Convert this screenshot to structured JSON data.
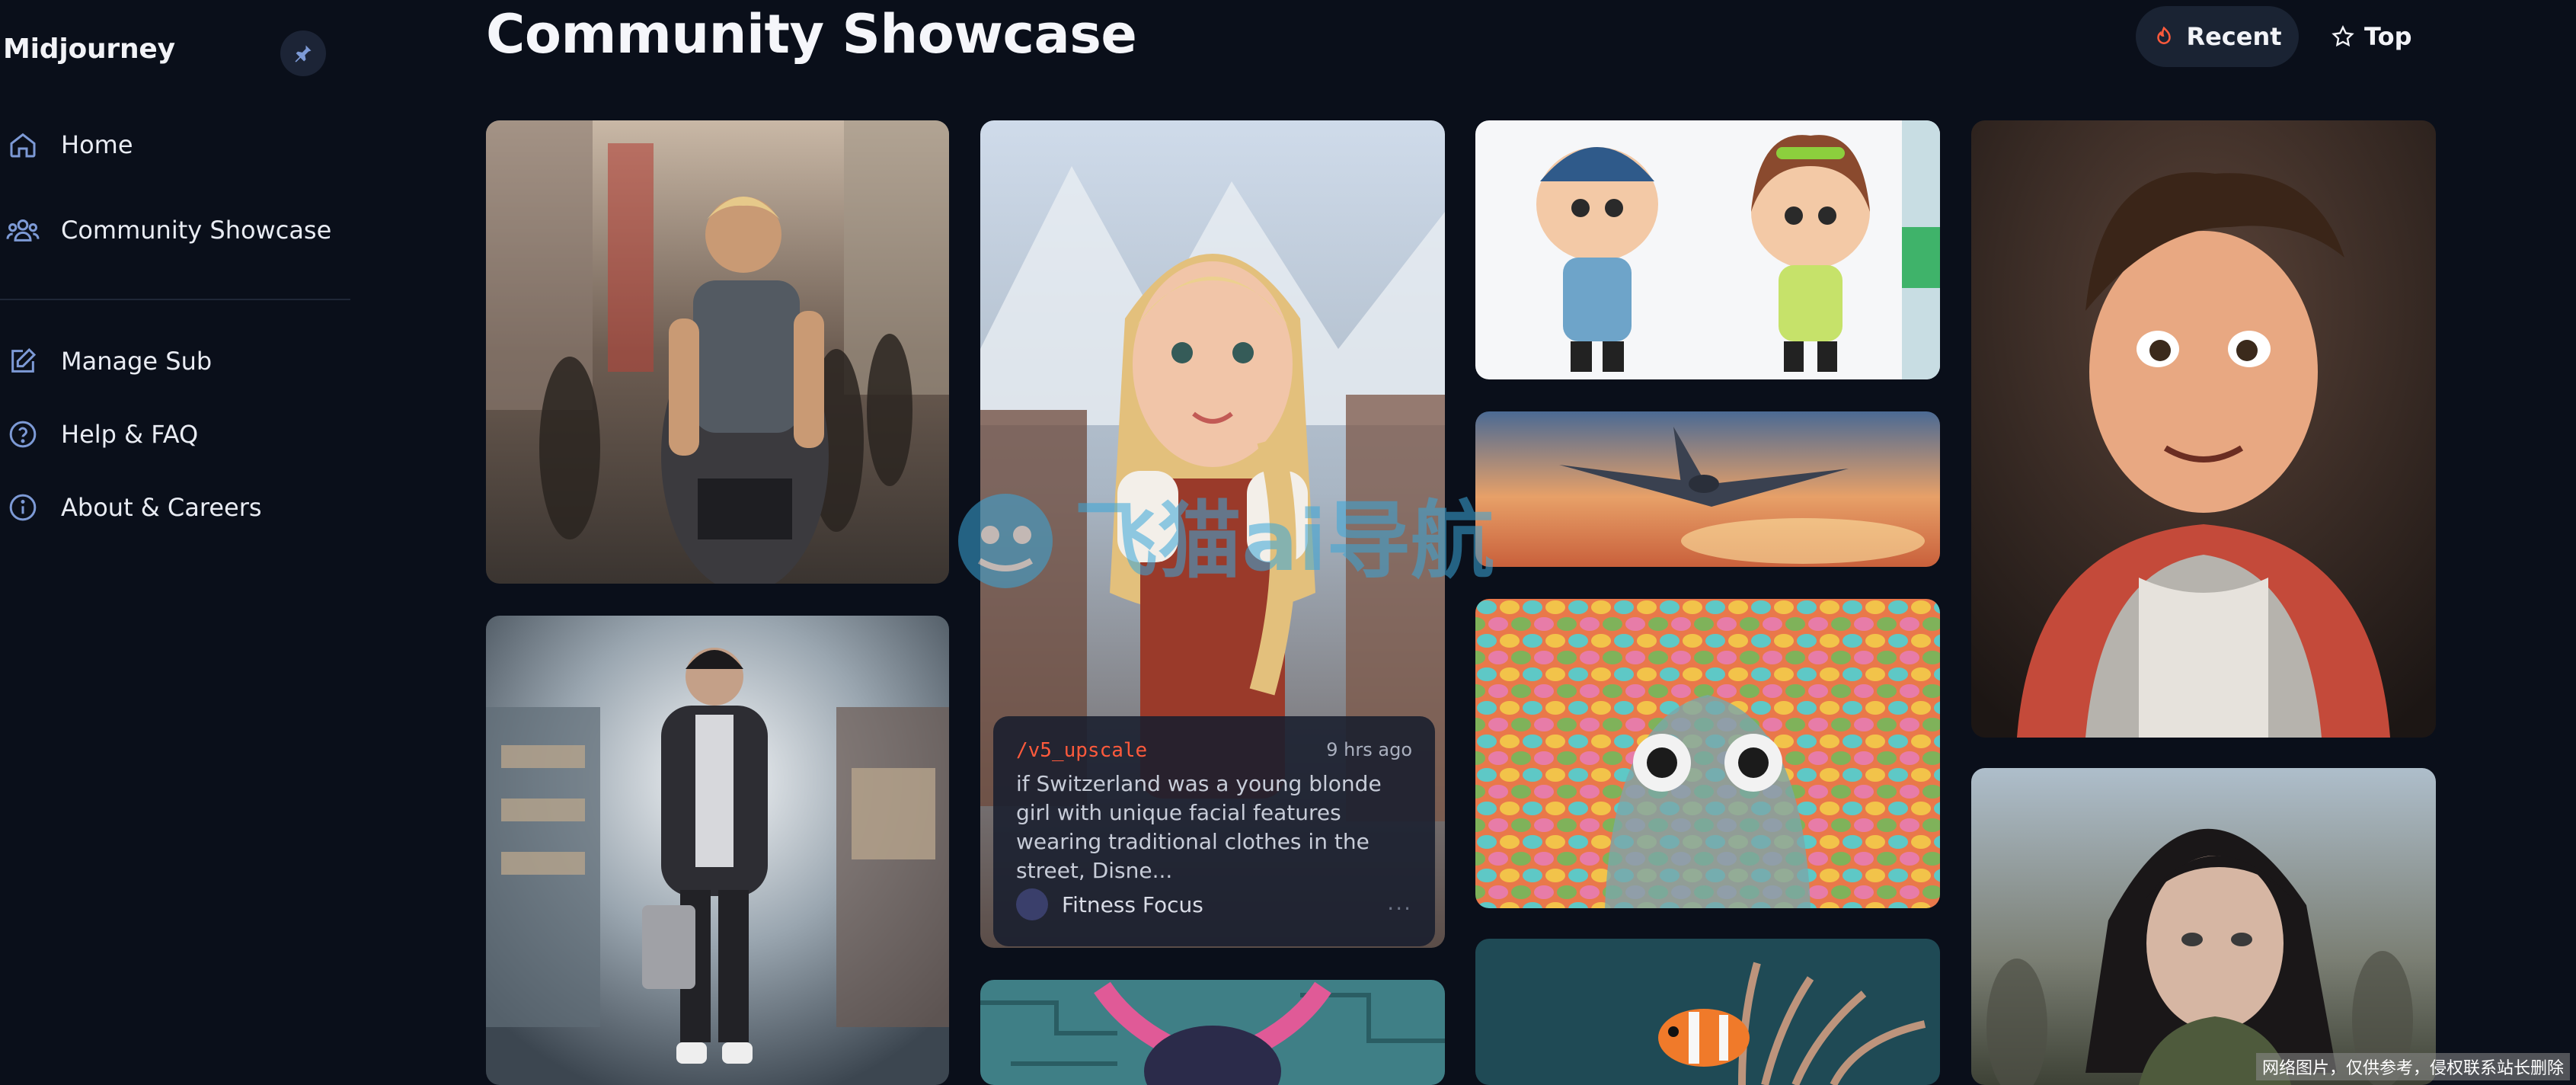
{
  "app": {
    "name": "Midjourney"
  },
  "sidebar": {
    "items": [
      {
        "label": "Home",
        "icon": "home-icon"
      },
      {
        "label": "Community Showcase",
        "icon": "users-icon"
      },
      {
        "label": "Manage Sub",
        "icon": "edit-icon"
      },
      {
        "label": "Help & FAQ",
        "icon": "help-icon"
      },
      {
        "label": "About & Careers",
        "icon": "info-icon"
      }
    ]
  },
  "header": {
    "title": "Community Showcase",
    "sort": {
      "recent_label": "Recent",
      "top_label": "Top",
      "active": "Recent"
    }
  },
  "gallery": {
    "tiles": [
      {
        "subject": "marathon runners in city street"
      },
      {
        "subject": "young man walking in shopping mall"
      },
      {
        "subject": "blonde girl in traditional Swiss clothes"
      },
      {
        "subject": "pink horned creature"
      },
      {
        "subject": "cartoon police officers"
      },
      {
        "subject": "airplane at sunset"
      },
      {
        "subject": "colorful scaled octopus"
      },
      {
        "subject": "clownfish in coral reef"
      },
      {
        "subject": "3D cartoon boy portrait"
      },
      {
        "subject": "dark haired woman portrait"
      }
    ],
    "hover_card": {
      "command": "/v5_upscale",
      "time": "9 hrs ago",
      "prompt": "if Switzerland was a young blonde girl with unique facial features wearing traditional clothes in the street, Disne...",
      "user": "Fitness Focus",
      "more": "···"
    }
  },
  "watermark": {
    "logo_text": "飞猫ai导航",
    "note": "网络图片，仅供参考，侵权联系站长删除"
  },
  "colors": {
    "background": "#0a0f1a",
    "accent": "#ff5a3c",
    "sidebar_icon": "#7d9ad6"
  }
}
